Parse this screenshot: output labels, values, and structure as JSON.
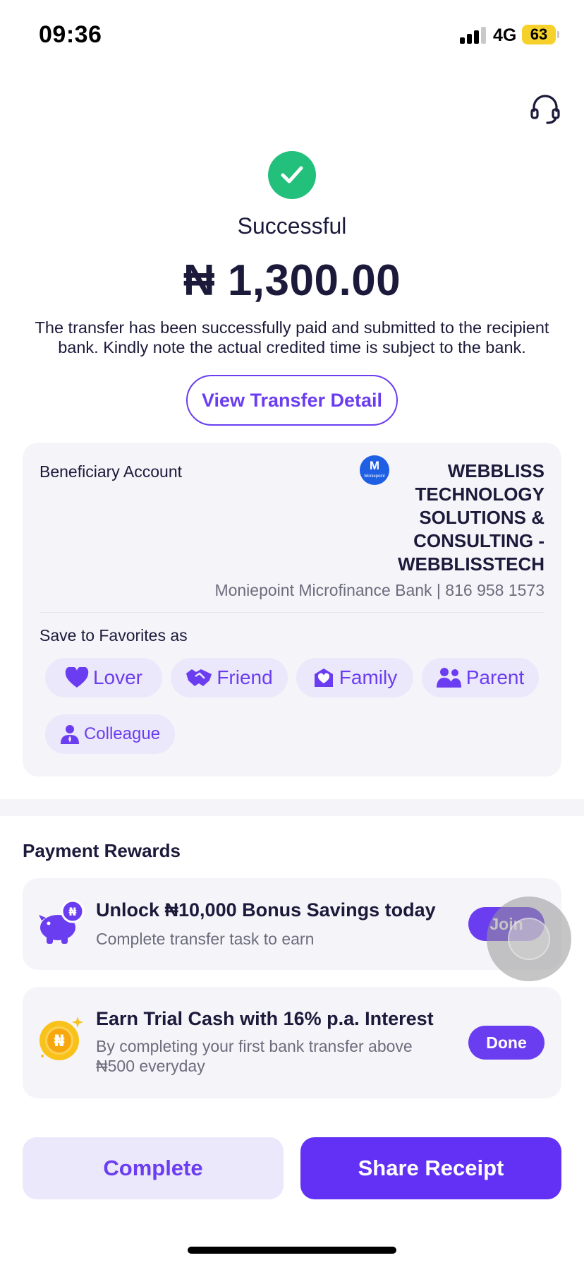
{
  "status_bar": {
    "time": "09:36",
    "network": "4G",
    "battery": "63"
  },
  "icons": {
    "support": "headset-icon",
    "success": "check-circle-icon"
  },
  "result": {
    "status": "Successful",
    "amount": "₦ 1,300.00",
    "note": "The transfer has been successfully paid and submitted to the recipient bank. Kindly note the actual credited time is subject to the bank."
  },
  "view_detail_label": "View Transfer Detail",
  "beneficiary": {
    "label": "Beneficiary Account",
    "bank_logo_letter": "M",
    "bank_logo_text": "Moniepoint",
    "name": "WEBBLISS TECHNOLOGY SOLUTIONS & CONSULTING - WEBBLISSTECH",
    "bank_line": "Moniepoint Microfinance Bank | 816 958 1573"
  },
  "favorites": {
    "label": "Save to Favorites as",
    "options": [
      "Lover",
      "Friend",
      "Family",
      "Parent",
      "Colleague"
    ]
  },
  "rewards": {
    "title": "Payment Rewards",
    "items": [
      {
        "title": "Unlock ₦10,000 Bonus Savings today",
        "subtitle": "Complete transfer task to earn",
        "button": "Join"
      },
      {
        "title": "Earn Trial Cash with 16% p.a. Interest",
        "subtitle": "By completing your first bank transfer above ₦500 everyday",
        "button": "Done"
      }
    ]
  },
  "actions": {
    "complete": "Complete",
    "share": "Share Receipt"
  },
  "colors": {
    "accent": "#6b3df0",
    "success": "#22c07a",
    "text": "#1c1a3a",
    "muted": "#6d6c7c"
  }
}
